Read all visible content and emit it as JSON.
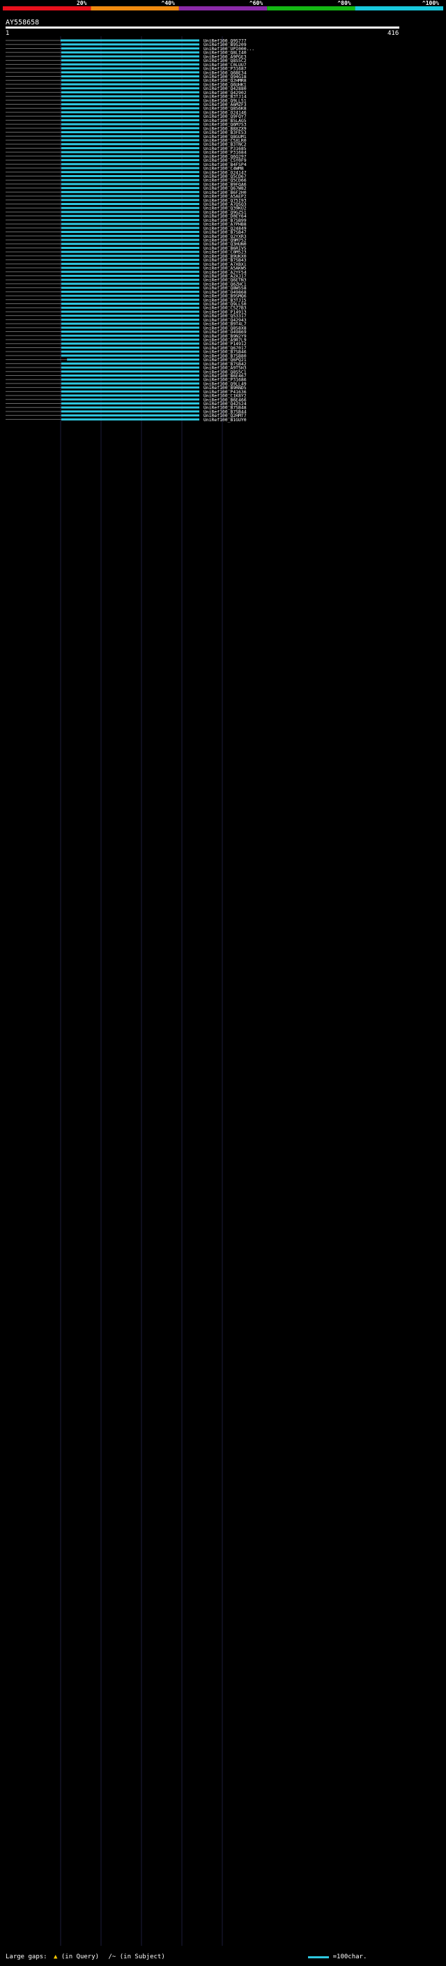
{
  "query_id": "AY558658",
  "query_start": "1",
  "query_end": "416",
  "colors": {
    "background": "#000000",
    "band_red": "#e8101c",
    "band_orange": "#f08a10",
    "band_purple": "#8a2aa8",
    "band_green": "#14b814",
    "band_cyan": "#18c8dc",
    "hit_cyan": "#2ec8e0",
    "hit_green": "#3aa82a",
    "gap": "#6a6a6a",
    "label": "#ffffff"
  },
  "identity_bands": [
    {
      "label": "20%",
      "color": "#e8101c"
    },
    {
      "label": "^40%",
      "color": "#f08a10"
    },
    {
      "label": "^60%",
      "color": "#8a2aa8"
    },
    {
      "label": "^80%",
      "color": "#14b814"
    },
    {
      "label": "^100%",
      "color": "#18c8dc"
    }
  ],
  "legend": {
    "large_gaps": "Large gaps:",
    "in_query": "(in Query)",
    "in_subject": "(in Subject)",
    "scale_label": "=100char."
  },
  "chart_data": {
    "type": "alignment-overview",
    "query_length": 416,
    "hits": [
      {
        "label": "UniRef100_Q9S777",
        "start": 1,
        "end": 416,
        "color": "cyan"
      },
      {
        "label": "UniRef100_B9S209",
        "start": 3,
        "end": 416,
        "color": "cyan"
      },
      {
        "label": "UniRef100_UPI000...",
        "start": 3,
        "end": 416,
        "color": "cyan"
      },
      {
        "label": "UniRef100_Q8LI40",
        "start": 3,
        "end": 416,
        "color": "cyan"
      },
      {
        "label": "UniRef100_A9PGE3",
        "start": 3,
        "end": 416,
        "color": "cyan"
      },
      {
        "label": "UniRef100_Q8S5C2",
        "start": 3,
        "end": 416,
        "color": "cyan"
      },
      {
        "label": "UniRef100_C0LUU7",
        "start": 3,
        "end": 416,
        "color": "cyan"
      },
      {
        "label": "UniRef100_P31687",
        "start": 3,
        "end": 416,
        "color": "cyan"
      },
      {
        "label": "UniRef100_Q6BE34",
        "start": 3,
        "end": 416,
        "color": "cyan"
      },
      {
        "label": "UniRef100_Q94G18",
        "start": 3,
        "end": 416,
        "color": "cyan"
      },
      {
        "label": "UniRef100_Q2HMR8",
        "start": 3,
        "end": 416,
        "color": "cyan"
      },
      {
        "label": "UniRef100_Q6UHK1",
        "start": 3,
        "end": 416,
        "color": "cyan"
      },
      {
        "label": "UniRef100_Q42880",
        "start": 3,
        "end": 416,
        "color": "cyan"
      },
      {
        "label": "UniRef100_Q42902",
        "start": 3,
        "end": 416,
        "color": "cyan"
      },
      {
        "label": "UniRef100_B3TJ14",
        "start": 3,
        "end": 416,
        "color": "cyan"
      },
      {
        "label": "UniRef100_Q9LL51",
        "start": 3,
        "end": 416,
        "color": "cyan"
      },
      {
        "label": "UniRef100_A6MZF3",
        "start": 3,
        "end": 416,
        "color": "cyan"
      },
      {
        "label": "UniRef100_Q8S6K8",
        "start": 3,
        "end": 416,
        "color": "cyan"
      },
      {
        "label": "UniRef100_O24146",
        "start": 3,
        "end": 416,
        "color": "cyan"
      },
      {
        "label": "UniRef100_Q9FQY7",
        "start": 3,
        "end": 416,
        "color": "cyan"
      },
      {
        "label": "UniRef100_B5LAG5",
        "start": 3,
        "end": 416,
        "color": "cyan"
      },
      {
        "label": "UniRef100_Q6M7S3",
        "start": 3,
        "end": 416,
        "color": "cyan"
      },
      {
        "label": "UniRef100_B8XZX9",
        "start": 3,
        "end": 416,
        "color": "cyan"
      },
      {
        "label": "UniRef100_B3FE53",
        "start": 3,
        "end": 416,
        "color": "cyan"
      },
      {
        "label": "UniRef100_Q8GUM1",
        "start": 3,
        "end": 416,
        "color": "cyan"
      },
      {
        "label": "UniRef100_C5XLR0",
        "start": 3,
        "end": 416,
        "color": "cyan"
      },
      {
        "label": "UniRef100_B3TNC2",
        "start": 3,
        "end": 416,
        "color": "cyan"
      },
      {
        "label": "UniRef100_P31685",
        "start": 3,
        "end": 416,
        "color": "cyan"
      },
      {
        "label": "UniRef100_P31684",
        "start": 3,
        "end": 416,
        "color": "cyan"
      },
      {
        "label": "UniRef100_Q6Q297",
        "start": 3,
        "end": 416,
        "color": "cyan"
      },
      {
        "label": "UniRef100_C5Y0F9",
        "start": 3,
        "end": 416,
        "color": "cyan"
      },
      {
        "label": "UniRef100_B4FSP4",
        "start": 3,
        "end": 416,
        "color": "cyan"
      },
      {
        "label": "UniRef100_C4WM8",
        "start": 3,
        "end": 416,
        "color": "cyan"
      },
      {
        "label": "UniRef100_O24147",
        "start": 3,
        "end": 416,
        "color": "cyan"
      },
      {
        "label": "UniRef100_Q5CD67",
        "start": 3,
        "end": 416,
        "color": "cyan"
      },
      {
        "label": "UniRef100_Q5CD66",
        "start": 3,
        "end": 416,
        "color": "cyan"
      },
      {
        "label": "UniRef100_B9FQA6",
        "start": 3,
        "end": 416,
        "color": "cyan"
      },
      {
        "label": "UniRef100_Q67W82",
        "start": 3,
        "end": 416,
        "color": "cyan"
      },
      {
        "label": "UniRef100_B6F2H0",
        "start": 3,
        "end": 416,
        "color": "cyan"
      },
      {
        "label": "UniRef100_A5AEP2",
        "start": 3,
        "end": 416,
        "color": "cyan"
      },
      {
        "label": "UniRef100_Q75I93",
        "start": 3,
        "end": 416,
        "color": "cyan"
      },
      {
        "label": "UniRef100_A7QSQ3",
        "start": 3,
        "end": 416,
        "color": "cyan"
      },
      {
        "label": "UniRef100_Q39KU2",
        "start": 3,
        "end": 416,
        "color": "cyan"
      },
      {
        "label": "UniRef100_Q9GZS1",
        "start": 3,
        "end": 416,
        "color": "cyan"
      },
      {
        "label": "UniRef100_D0EY64",
        "start": 3,
        "end": 416,
        "color": "cyan"
      },
      {
        "label": "UniRef100_B7SB99",
        "start": 3,
        "end": 416,
        "color": "cyan"
      },
      {
        "label": "UniRef100_A7PHB8",
        "start": 3,
        "end": 416,
        "color": "cyan"
      },
      {
        "label": "UniRef100_Q24849",
        "start": 3,
        "end": 416,
        "color": "cyan"
      },
      {
        "label": "UniRef100_B7SB47",
        "start": 3,
        "end": 416,
        "color": "cyan"
      },
      {
        "label": "UniRef100_Q2YXR3",
        "start": 3,
        "end": 416,
        "color": "cyan"
      },
      {
        "label": "UniRef100_Q9M752",
        "start": 3,
        "end": 416,
        "color": "cyan"
      },
      {
        "label": "UniRef100_Q3HUN0",
        "start": 3,
        "end": 416,
        "color": "cyan"
      },
      {
        "label": "UniRef100_B6RIV5",
        "start": 3,
        "end": 416,
        "color": "cyan"
      },
      {
        "label": "UniRef100_C0M523",
        "start": 3,
        "end": 416,
        "color": "cyan"
      },
      {
        "label": "UniRef100_B9UKX0",
        "start": 3,
        "end": 416,
        "color": "cyan"
      },
      {
        "label": "UniRef100_B7SB43",
        "start": 3,
        "end": 416,
        "color": "cyan"
      },
      {
        "label": "UniRef100_A7XBX1",
        "start": 3,
        "end": 416,
        "color": "cyan"
      },
      {
        "label": "UniRef100_A5AKW5",
        "start": 3,
        "end": 416,
        "color": "cyan"
      },
      {
        "label": "UniRef100_A2YF54",
        "start": 3,
        "end": 416,
        "color": "cyan"
      },
      {
        "label": "UniRef100_A2XJ17",
        "start": 3,
        "end": 416,
        "color": "cyan"
      },
      {
        "label": "UniRef100_Q6ETN3",
        "start": 3,
        "end": 416,
        "color": "cyan"
      },
      {
        "label": "UniRef100_Q6ZHC1",
        "start": 3,
        "end": 416,
        "color": "cyan"
      },
      {
        "label": "UniRef100_Q8W5S8",
        "start": 3,
        "end": 416,
        "color": "cyan"
      },
      {
        "label": "UniRef100_O49868",
        "start": 3,
        "end": 416,
        "color": "cyan"
      },
      {
        "label": "UniRef100_B9SMQ6",
        "start": 3,
        "end": 416,
        "color": "cyan"
      },
      {
        "label": "UniRef100_B3TJ15",
        "start": 3,
        "end": 416,
        "color": "cyan"
      },
      {
        "label": "UniRef100_Q9LL50",
        "start": 3,
        "end": 416,
        "color": "cyan"
      },
      {
        "label": "UniRef100_C5Z7B3",
        "start": 3,
        "end": 416,
        "color": "cyan"
      },
      {
        "label": "UniRef100_P14913",
        "start": 3,
        "end": 416,
        "color": "cyan"
      },
      {
        "label": "UniRef100_Q53317",
        "start": 3,
        "end": 416,
        "color": "cyan"
      },
      {
        "label": "UniRef100_Q42943",
        "start": 3,
        "end": 416,
        "color": "cyan"
      },
      {
        "label": "UniRef100_B9T4L7",
        "start": 3,
        "end": 416,
        "color": "cyan"
      },
      {
        "label": "UniRef100_Q8S8X8",
        "start": 3,
        "end": 416,
        "color": "cyan"
      },
      {
        "label": "UniRef100_O49869",
        "start": 3,
        "end": 416,
        "color": "cyan"
      },
      {
        "label": "UniRef100_B9N2Y9",
        "start": 3,
        "end": 416,
        "color": "cyan"
      },
      {
        "label": "UniRef100_A9R7L9",
        "start": 3,
        "end": 416,
        "color": "cyan"
      },
      {
        "label": "UniRef100_P14912",
        "start": 3,
        "end": 416,
        "color": "cyan"
      },
      {
        "label": "UniRef100_Q67017",
        "start": 3,
        "end": 416,
        "color": "cyan"
      },
      {
        "label": "UniRef100_B7SB46",
        "start": 3,
        "end": 416,
        "color": "cyan"
      },
      {
        "label": "UniRef100_B7SB80",
        "start": 3,
        "end": 416,
        "color": "cyan"
      },
      {
        "label": "UniRef100_Q6PQ21",
        "start": 20,
        "end": 416,
        "color": "cyan"
      },
      {
        "label": "UniRef100_B7SB42",
        "start": 3,
        "end": 416,
        "color": "cyan"
      },
      {
        "label": "UniRef100_A9T5H3",
        "start": 3,
        "end": 416,
        "color": "cyan"
      },
      {
        "label": "UniRef100_Q8S5C1",
        "start": 3,
        "end": 416,
        "color": "cyan"
      },
      {
        "label": "UniRef100_B6E467",
        "start": 3,
        "end": 416,
        "color": "cyan"
      },
      {
        "label": "UniRef100_P31686",
        "start": 3,
        "end": 416,
        "color": "cyan"
      },
      {
        "label": "UniRef100_Q9LL49",
        "start": 3,
        "end": 416,
        "color": "cyan"
      },
      {
        "label": "UniRef100_B9RND5",
        "start": 3,
        "end": 416,
        "color": "cyan"
      },
      {
        "label": "UniRef100_P41636",
        "start": 3,
        "end": 416,
        "color": "cyan"
      },
      {
        "label": "UniRef100_C1K8Y2",
        "start": 3,
        "end": 416,
        "color": "cyan"
      },
      {
        "label": "UniRef100_B6E466",
        "start": 3,
        "end": 416,
        "color": "cyan"
      },
      {
        "label": "UniRef100_Q42524",
        "start": 3,
        "end": 416,
        "color": "cyan"
      },
      {
        "label": "UniRef100_B7SB48",
        "start": 3,
        "end": 416,
        "color": "cyan"
      },
      {
        "label": "UniRef100_B7SB44",
        "start": 3,
        "end": 416,
        "color": "cyan"
      },
      {
        "label": "UniRef100_Q2HMT7",
        "start": 3,
        "end": 416,
        "color": "cyan"
      },
      {
        "label": "UniRef100_B1GUY0",
        "start": 3,
        "end": 416,
        "color": "cyan"
      }
    ]
  }
}
